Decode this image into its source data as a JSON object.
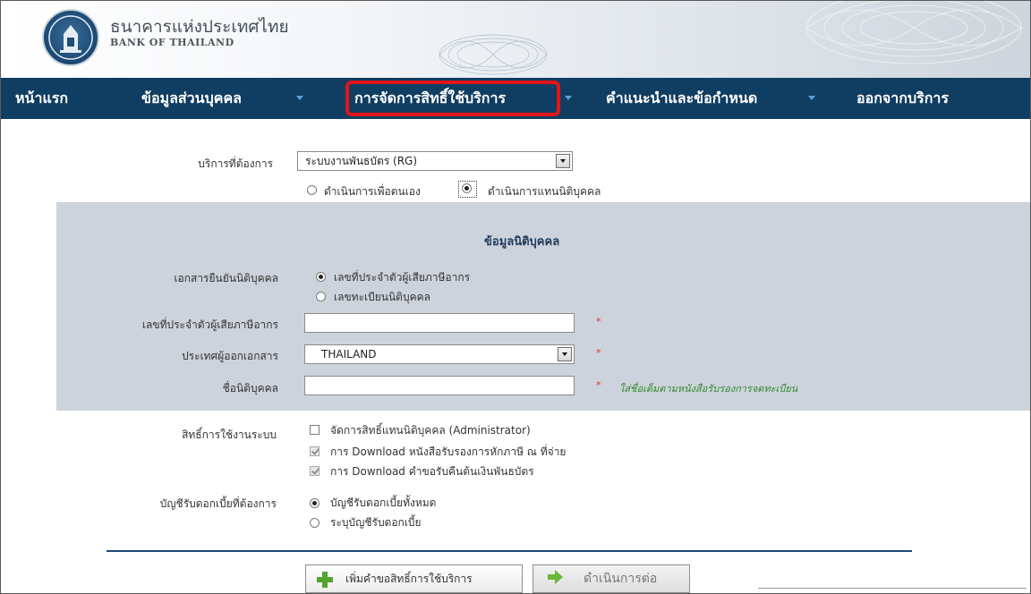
{
  "header": {
    "brand_th": "ธนาคารแห่งประเทศไทย",
    "brand_en": "BANK OF THAILAND"
  },
  "nav": {
    "items": [
      {
        "label": "หน้าแรก",
        "dropdown": false
      },
      {
        "label": "ข้อมูลส่วนบุคคล",
        "dropdown": true
      },
      {
        "label": "การจัดการสิทธิ์ใช้บริการ",
        "dropdown": true,
        "highlighted": true
      },
      {
        "label": "คำแนะนำและข้อกำหนด",
        "dropdown": true
      },
      {
        "label": "ออกจากบริการ",
        "dropdown": false
      }
    ],
    "highlight_color": "#e3141b",
    "background": "#103d62"
  },
  "form": {
    "service_label": "บริการที่ต้องการ",
    "service_value": "ระบบงานพันธบัตร (RG)",
    "mode_self": "ดำเนินการเพื่อตนเอง",
    "mode_corp": "ดำเนินการแทนนิติบุคคล",
    "mode_selected": "corp"
  },
  "panel": {
    "title": "ข้อมูลนิติบุคคล",
    "doc_label": "เอกสารยืนยันนิติบุคคล",
    "doc_opt_tax": "เลขที่ประจำตัวผู้เสียภาษีอากร",
    "doc_opt_reg": "เลขทะเบียนนิติบุคคล",
    "tax_id_label": "เลขที่ประจำตัวผู้เสียภาษีอากร",
    "tax_id_value": "",
    "country_label": "ประเทศผู้ออกเอกสาร",
    "country_value": "THAILAND",
    "name_label": "ชื่อนิติบุคคล",
    "name_value": "",
    "name_note": "ใส่ชื่อเต็มตามหนังสือรับรองการจดทะเบียน",
    "required_mark": "*"
  },
  "rights": {
    "label": "สิทธิ์การใช้งานระบบ",
    "admin": "จัดการสิทธิ์แทนนิติบุคคล (Administrator)",
    "download_tax": "การ Download หนังสือรับรองการหักภาษี ณ ที่จ่าย",
    "download_refund": "การ Download คำขอรับคืนต้นเงินพันธบัตร"
  },
  "accounts": {
    "label": "บัญชีรับดอกเบี้ยที่ต้องการ",
    "opt_all": "บัญชีรับดอกเบี้ยทั้งหมด",
    "opt_specify": "ระบุบัญชีรับดอกเบี้ย"
  },
  "buttons": {
    "add_request": "เพิ่มคำขอสิทธิ์การใช้บริการ",
    "continue": "ดำเนินการต่อ"
  }
}
